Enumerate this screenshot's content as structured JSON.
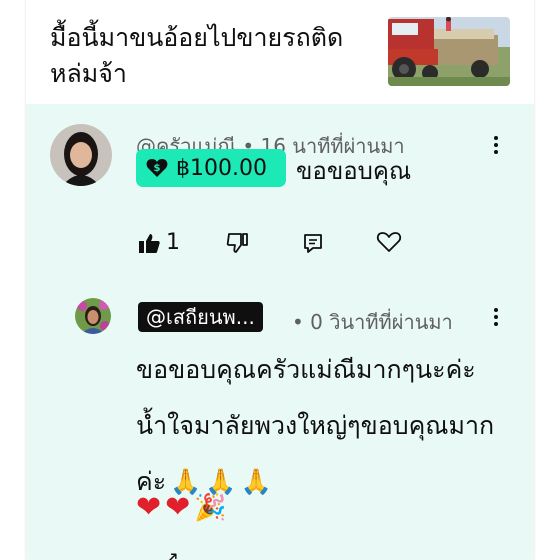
{
  "video": {
    "title": "มื้อนี้มาขนอ้อยไปขายรถติดหล่มจ้า",
    "thumbnail": "video-thumbnail"
  },
  "comment": {
    "author": "@ครัวแม่ณี",
    "time": "16 นาทีที่ผ่านมา",
    "separator": "•",
    "thanks_amount": "฿100.00",
    "text": "ขอขอบคุณ",
    "like_count": "1",
    "thanks_color": "#1de9b6"
  },
  "reply": {
    "author": "@เสถียนพ...",
    "time": "0 วินาทีที่ผ่านมา",
    "separator": "•",
    "text": "ขอขอบคุณครัวแม่ณีมากๆนะค่ะน้ำใจมาลัยพวงใหญ่ๆขอบคุณมากค่ะ",
    "prayer_emoji": "🙏",
    "heart_emoji": "❤",
    "party_emoji": "🎉"
  }
}
